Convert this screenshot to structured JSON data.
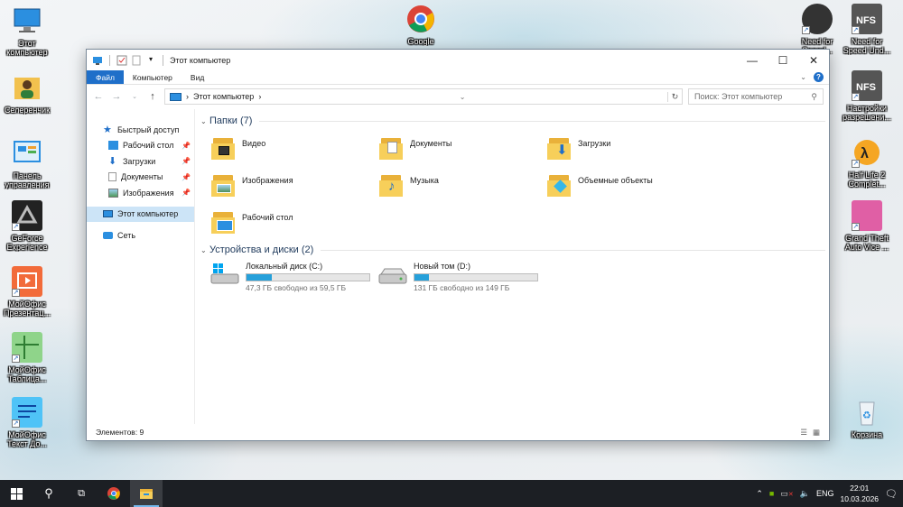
{
  "desktop": {
    "icons_left": [
      {
        "label": "Этот\nкомпьютер"
      },
      {
        "label": "Селеренчик"
      },
      {
        "label": "Панель\nуправления"
      },
      {
        "label": "GeForce\nExperience"
      },
      {
        "label": "МойОфис\nПрезентац..."
      },
      {
        "label": "МойОфис\nТаблица..."
      },
      {
        "label": "МойОфис\nТекст До..."
      }
    ],
    "icons_top": [
      {
        "label": "Google"
      }
    ],
    "icons_right": [
      {
        "label": "Need for\nSpeed..."
      },
      {
        "label": "Need for\nSpeed Und..."
      },
      {
        "label": "Настройки\nразрешени..."
      },
      {
        "label": "Half Life 2\nComplet..."
      },
      {
        "label": "Grand Theft\nAuto Vice ..."
      },
      {
        "label": "Корзина"
      }
    ]
  },
  "window": {
    "title": "Этот компьютер",
    "ribbon_tabs": [
      "Файл",
      "Компьютер",
      "Вид"
    ],
    "address": {
      "path": "Этот компьютер",
      "separator": "›"
    },
    "search": {
      "placeholder": "Поиск: Этот компьютер"
    },
    "nav": {
      "quick_access": "Быстрый доступ",
      "quick_items": [
        "Рабочий стол",
        "Загрузки",
        "Документы",
        "Изображения"
      ],
      "this_pc": "Этот компьютер",
      "network": "Сеть"
    },
    "folders_header": "Папки (7)",
    "folders": [
      "Видео",
      "Документы",
      "Загрузки",
      "Изображения",
      "Музыка",
      "Объемные объекты",
      "Рабочий стол"
    ],
    "drives_header": "Устройства и диски (2)",
    "drives": [
      {
        "name": "Локальный диск (C:)",
        "free": "47,3 ГБ свободно из 59,5 ГБ",
        "used_fraction": 0.205
      },
      {
        "name": "Новый том (D:)",
        "free": "131 ГБ свободно из 149 ГБ",
        "used_fraction": 0.12
      }
    ],
    "status": "Элементов: 9"
  },
  "taskbar": {
    "lang": "ENG",
    "time": "22:01",
    "date": "10.03.2026"
  },
  "colors": {
    "accent": "#1f6fc9",
    "drive_fill": "#26a0da",
    "taskbar": "#1c1f24"
  }
}
